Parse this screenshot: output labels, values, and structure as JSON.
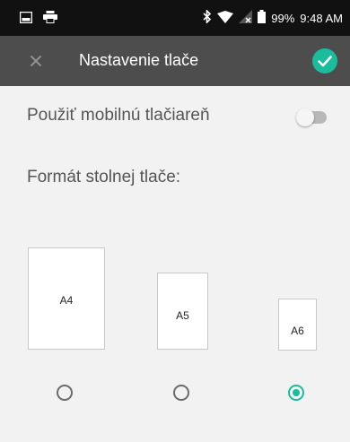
{
  "status_bar": {
    "battery": "99%",
    "time": "9:48 AM",
    "icons": [
      "image-notification-icon",
      "print-notification-icon",
      "bluetooth-icon",
      "wifi-icon",
      "signal-icon",
      "battery-icon"
    ]
  },
  "toolbar": {
    "title": "Nastavenie tlače",
    "close_icon": "close-icon",
    "confirm_icon": "check-icon",
    "accent_color": "#1abc9c",
    "background_color": "#4d4d4d"
  },
  "settings": {
    "mobile_printer_label": "Použiť mobilnú tlačiareň",
    "mobile_printer_enabled": false,
    "format_label": "Formát stolnej tlače:"
  },
  "formats": [
    {
      "label": "A4",
      "selected": false
    },
    {
      "label": "A5",
      "selected": false
    },
    {
      "label": "A6",
      "selected": true
    }
  ]
}
